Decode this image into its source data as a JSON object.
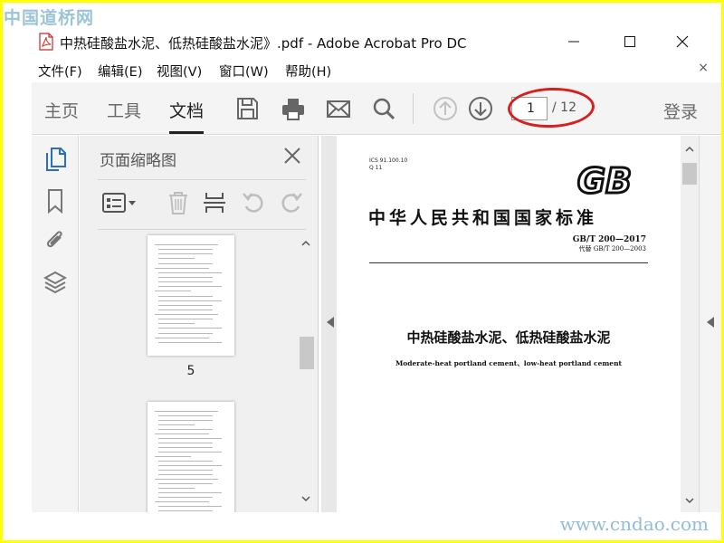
{
  "watermark": {
    "top": "中国道桥网",
    "bottom": "www.cndao.com"
  },
  "window": {
    "title": "中热硅酸盐水泥、低热硅酸盐水泥》.pdf - Adobe Acrobat Pro DC",
    "controls": {
      "minimize": "minimize",
      "maximize": "maximize",
      "close": "close"
    }
  },
  "menu": {
    "items": [
      "文件(F)",
      "编辑(E)",
      "视图(V)",
      "窗口(W)",
      "帮助(H)"
    ],
    "close_glyph": "×"
  },
  "toolbar": {
    "tabs": [
      "主页",
      "工具",
      "文档"
    ],
    "active_tab": "文档",
    "icons": [
      "save-icon",
      "print-icon",
      "mail-icon",
      "search-icon",
      "previous-page-icon",
      "next-page-icon"
    ],
    "page_current": "1",
    "page_total": "/ 12",
    "login": "登录",
    "highlight_color": "#d42020"
  },
  "left_strip": {
    "icons": [
      "page-thumbnails-icon",
      "bookmark-icon",
      "attachment-icon",
      "layers-icon"
    ],
    "active": "page-thumbnails-icon",
    "active_color": "#2a6ebf"
  },
  "thumbnail_panel": {
    "title": "页面缩略图",
    "tools": [
      "options-menu-icon",
      "delete-icon",
      "extract-icon",
      "rotate-left-icon",
      "rotate-right-icon"
    ],
    "thumbnails": [
      {
        "label": "5"
      },
      {
        "label": ""
      }
    ]
  },
  "document": {
    "ics": "ICS 91.100.10",
    "ccs": "Q 11",
    "logo": "GB",
    "national_title": "中华人民共和国国家标准",
    "standard_no": "GB/T 200—2017",
    "replaces": "代替 GB/T 200—2003",
    "title_cn": "中热硅酸盐水泥、低热硅酸盐水泥",
    "title_en": "Moderate-heat portland cement、low-heat portland cement"
  }
}
